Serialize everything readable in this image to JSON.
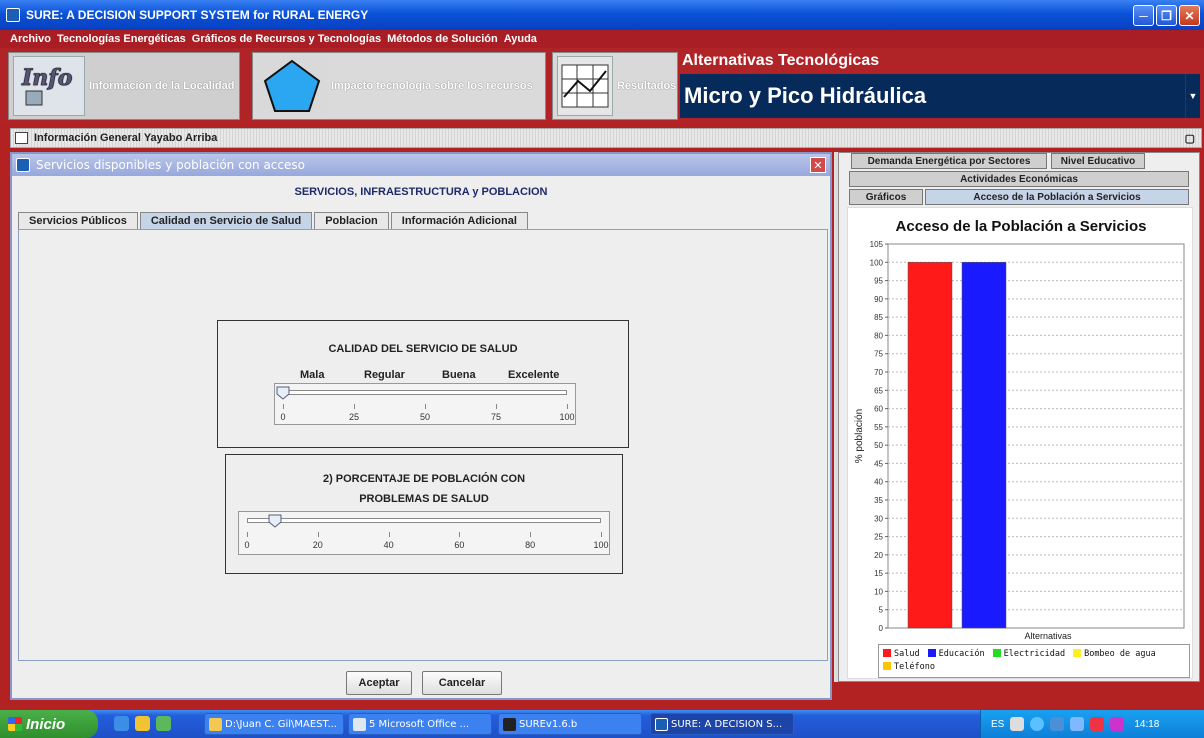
{
  "window": {
    "title": "SURE: A DECISION SUPPORT SYSTEM for RURAL ENERGY"
  },
  "menu": [
    "Archivo",
    "Tecnologías Energéticas",
    "Gráficos de Recursos y Tecnologías",
    "Métodos de Solución",
    "Ayuda"
  ],
  "toolbar": {
    "info_label": "Información de la Localidad",
    "impact_label": "Impacto tecnología sobre los recursos",
    "results_label": "Resultados",
    "alternatives_title": "Alternativas Tecnológicas",
    "selected_alternative": "Micro y Pico Hidráulica"
  },
  "info_frame": {
    "title": "Información General Yayabo Arriba"
  },
  "dialog": {
    "title": "Servicios disponibles y población con acceso",
    "heading": "SERVICIOS, INFRAESTRUCTURA y POBLACION",
    "tabs": [
      "Servicios Públicos",
      "Calidad en Servicio de Salud",
      "Poblacion",
      "Información Adicional"
    ],
    "active_tab": "Calidad en Servicio de Salud",
    "slider1": {
      "title": "CALIDAD DEL SERVICIO DE SALUD",
      "labels": [
        "Mala",
        "Regular",
        "Buena",
        "Excelente"
      ],
      "ticks": [
        "0",
        "25",
        "50",
        "75",
        "100"
      ],
      "value": 0
    },
    "slider2": {
      "title_line1": "2) PORCENTAJE DE POBLACIÓN CON",
      "title_line2": "PROBLEMAS DE SALUD",
      "ticks": [
        "0",
        "20",
        "40",
        "60",
        "80",
        "100"
      ],
      "value": 8
    },
    "accept_label": "Aceptar",
    "cancel_label": "Cancelar"
  },
  "right_panel": {
    "tabs_row1": [
      "Demanda Energética por Sectores",
      "Nivel Educativo"
    ],
    "tabs_row2": [
      "Actividades Económicas"
    ],
    "tabs_row3": [
      "Gráficos",
      "Acceso de la Población a Servicios"
    ],
    "active_tab": "Acceso de la Población a Servicios"
  },
  "chart_data": {
    "type": "bar",
    "title": "Acceso de la Población a Servicios",
    "xlabel": "Alternativas",
    "ylabel": "% población",
    "ylim": [
      0,
      105
    ],
    "yticks": [
      0,
      5,
      10,
      15,
      20,
      25,
      30,
      35,
      40,
      45,
      50,
      55,
      60,
      65,
      70,
      75,
      80,
      85,
      90,
      95,
      100,
      105
    ],
    "grid": true,
    "legend_position": "bottom",
    "series": [
      {
        "name": "Salud",
        "value": 100,
        "color": "#ff1a1a"
      },
      {
        "name": "Educación",
        "value": 100,
        "color": "#1a1aff"
      },
      {
        "name": "Electricidad",
        "value": 0,
        "color": "#22dd22"
      },
      {
        "name": "Bombeo de agua",
        "value": 0,
        "color": "#ffee22"
      },
      {
        "name": "Teléfono",
        "value": 0,
        "color": "#ffc400"
      }
    ]
  },
  "taskbar": {
    "start_label": "Inicio",
    "tasks": [
      "D:\\Juan C. Gil\\MAEST...",
      "5 Microsoft Office ...",
      "SUREv1.6.b",
      "SURE: A DECISION S..."
    ],
    "language": "ES",
    "clock": "14:18"
  }
}
